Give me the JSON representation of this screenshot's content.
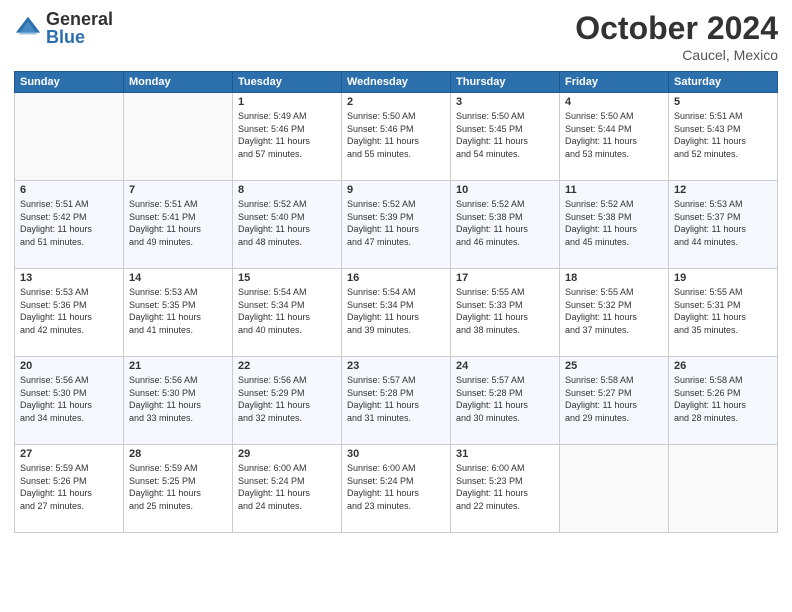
{
  "header": {
    "logo_general": "General",
    "logo_blue": "Blue",
    "title": "October 2024",
    "location": "Caucel, Mexico"
  },
  "days_header": [
    "Sunday",
    "Monday",
    "Tuesday",
    "Wednesday",
    "Thursday",
    "Friday",
    "Saturday"
  ],
  "weeks": [
    [
      {
        "day": "",
        "info": ""
      },
      {
        "day": "",
        "info": ""
      },
      {
        "day": "1",
        "info": "Sunrise: 5:49 AM\nSunset: 5:46 PM\nDaylight: 11 hours\nand 57 minutes."
      },
      {
        "day": "2",
        "info": "Sunrise: 5:50 AM\nSunset: 5:46 PM\nDaylight: 11 hours\nand 55 minutes."
      },
      {
        "day": "3",
        "info": "Sunrise: 5:50 AM\nSunset: 5:45 PM\nDaylight: 11 hours\nand 54 minutes."
      },
      {
        "day": "4",
        "info": "Sunrise: 5:50 AM\nSunset: 5:44 PM\nDaylight: 11 hours\nand 53 minutes."
      },
      {
        "day": "5",
        "info": "Sunrise: 5:51 AM\nSunset: 5:43 PM\nDaylight: 11 hours\nand 52 minutes."
      }
    ],
    [
      {
        "day": "6",
        "info": "Sunrise: 5:51 AM\nSunset: 5:42 PM\nDaylight: 11 hours\nand 51 minutes."
      },
      {
        "day": "7",
        "info": "Sunrise: 5:51 AM\nSunset: 5:41 PM\nDaylight: 11 hours\nand 49 minutes."
      },
      {
        "day": "8",
        "info": "Sunrise: 5:52 AM\nSunset: 5:40 PM\nDaylight: 11 hours\nand 48 minutes."
      },
      {
        "day": "9",
        "info": "Sunrise: 5:52 AM\nSunset: 5:39 PM\nDaylight: 11 hours\nand 47 minutes."
      },
      {
        "day": "10",
        "info": "Sunrise: 5:52 AM\nSunset: 5:38 PM\nDaylight: 11 hours\nand 46 minutes."
      },
      {
        "day": "11",
        "info": "Sunrise: 5:52 AM\nSunset: 5:38 PM\nDaylight: 11 hours\nand 45 minutes."
      },
      {
        "day": "12",
        "info": "Sunrise: 5:53 AM\nSunset: 5:37 PM\nDaylight: 11 hours\nand 44 minutes."
      }
    ],
    [
      {
        "day": "13",
        "info": "Sunrise: 5:53 AM\nSunset: 5:36 PM\nDaylight: 11 hours\nand 42 minutes."
      },
      {
        "day": "14",
        "info": "Sunrise: 5:53 AM\nSunset: 5:35 PM\nDaylight: 11 hours\nand 41 minutes."
      },
      {
        "day": "15",
        "info": "Sunrise: 5:54 AM\nSunset: 5:34 PM\nDaylight: 11 hours\nand 40 minutes."
      },
      {
        "day": "16",
        "info": "Sunrise: 5:54 AM\nSunset: 5:34 PM\nDaylight: 11 hours\nand 39 minutes."
      },
      {
        "day": "17",
        "info": "Sunrise: 5:55 AM\nSunset: 5:33 PM\nDaylight: 11 hours\nand 38 minutes."
      },
      {
        "day": "18",
        "info": "Sunrise: 5:55 AM\nSunset: 5:32 PM\nDaylight: 11 hours\nand 37 minutes."
      },
      {
        "day": "19",
        "info": "Sunrise: 5:55 AM\nSunset: 5:31 PM\nDaylight: 11 hours\nand 35 minutes."
      }
    ],
    [
      {
        "day": "20",
        "info": "Sunrise: 5:56 AM\nSunset: 5:30 PM\nDaylight: 11 hours\nand 34 minutes."
      },
      {
        "day": "21",
        "info": "Sunrise: 5:56 AM\nSunset: 5:30 PM\nDaylight: 11 hours\nand 33 minutes."
      },
      {
        "day": "22",
        "info": "Sunrise: 5:56 AM\nSunset: 5:29 PM\nDaylight: 11 hours\nand 32 minutes."
      },
      {
        "day": "23",
        "info": "Sunrise: 5:57 AM\nSunset: 5:28 PM\nDaylight: 11 hours\nand 31 minutes."
      },
      {
        "day": "24",
        "info": "Sunrise: 5:57 AM\nSunset: 5:28 PM\nDaylight: 11 hours\nand 30 minutes."
      },
      {
        "day": "25",
        "info": "Sunrise: 5:58 AM\nSunset: 5:27 PM\nDaylight: 11 hours\nand 29 minutes."
      },
      {
        "day": "26",
        "info": "Sunrise: 5:58 AM\nSunset: 5:26 PM\nDaylight: 11 hours\nand 28 minutes."
      }
    ],
    [
      {
        "day": "27",
        "info": "Sunrise: 5:59 AM\nSunset: 5:26 PM\nDaylight: 11 hours\nand 27 minutes."
      },
      {
        "day": "28",
        "info": "Sunrise: 5:59 AM\nSunset: 5:25 PM\nDaylight: 11 hours\nand 25 minutes."
      },
      {
        "day": "29",
        "info": "Sunrise: 6:00 AM\nSunset: 5:24 PM\nDaylight: 11 hours\nand 24 minutes."
      },
      {
        "day": "30",
        "info": "Sunrise: 6:00 AM\nSunset: 5:24 PM\nDaylight: 11 hours\nand 23 minutes."
      },
      {
        "day": "31",
        "info": "Sunrise: 6:00 AM\nSunset: 5:23 PM\nDaylight: 11 hours\nand 22 minutes."
      },
      {
        "day": "",
        "info": ""
      },
      {
        "day": "",
        "info": ""
      }
    ]
  ]
}
